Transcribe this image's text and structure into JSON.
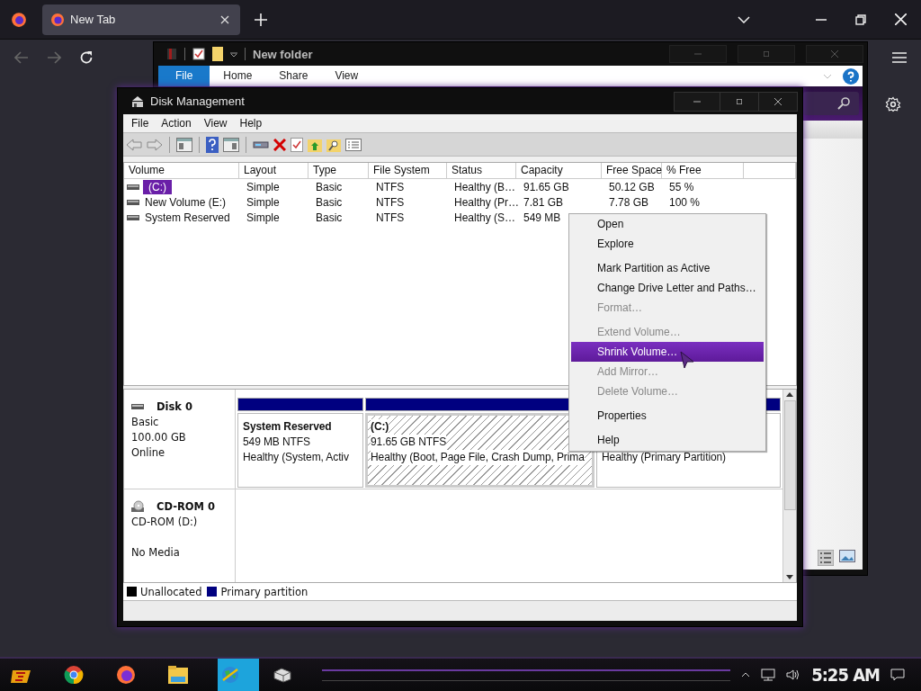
{
  "browser": {
    "tabs": [
      {
        "title": "New Tab",
        "selected": true
      }
    ]
  },
  "explorer": {
    "title": "New folder",
    "ribbon_tabs": [
      {
        "label": "File",
        "selected": true
      },
      {
        "label": "Home",
        "selected": false
      },
      {
        "label": "Share",
        "selected": false
      },
      {
        "label": "View",
        "selected": false
      }
    ]
  },
  "disk_management": {
    "title": "Disk Management",
    "menu": [
      "File",
      "Action",
      "View",
      "Help"
    ],
    "volume_table": {
      "columns": [
        "Volume",
        "Layout",
        "Type",
        "File System",
        "Status",
        "Capacity",
        "Free Space",
        "% Free"
      ],
      "rows": [
        {
          "cells": [
            "(C:)",
            "Simple",
            "Basic",
            "NTFS",
            "Healthy (B…",
            "91.65 GB",
            "50.12 GB",
            "55 %"
          ],
          "selected": true
        },
        {
          "cells": [
            "New Volume (E:)",
            "Simple",
            "Basic",
            "NTFS",
            "Healthy (Pr…",
            "7.81 GB",
            "7.78 GB",
            "100 %"
          ],
          "selected": false
        },
        {
          "cells": [
            "System Reserved",
            "Simple",
            "Basic",
            "NTFS",
            "Healthy (S…",
            "549 MB"
          ],
          "selected": false
        }
      ]
    },
    "disks": [
      {
        "name": "Disk 0",
        "kind": "disk",
        "type": "Basic",
        "size": "100.00 GB",
        "status": "Online",
        "partitions": [
          {
            "title": "System Reserved",
            "size": "549 MB NTFS",
            "status": "Healthy (System, Activ",
            "selected": false
          },
          {
            "title": "(C:)",
            "size": "91.65 GB NTFS",
            "status": "Healthy (Boot, Page File, Crash Dump, Prima",
            "selected": true
          },
          {
            "status": "Healthy (Primary Partition)",
            "selected": false
          }
        ]
      },
      {
        "name": "CD-ROM 0",
        "kind": "cdrom",
        "type": "CD-ROM (D:)",
        "status": "No Media"
      }
    ],
    "legend": [
      {
        "label": "Unallocated",
        "color": "#000000"
      },
      {
        "label": "Primary partition",
        "color": "#000080"
      }
    ]
  },
  "context_menu": {
    "groups": [
      [
        {
          "label": "Open",
          "disabled": false,
          "selected": false
        },
        {
          "label": "Explore",
          "disabled": false,
          "selected": false
        }
      ],
      [
        {
          "label": "Mark Partition as Active",
          "disabled": false,
          "selected": false
        },
        {
          "label": "Change Drive Letter and Paths…",
          "disabled": false,
          "selected": false
        },
        {
          "label": "Format…",
          "disabled": true,
          "selected": false
        }
      ],
      [
        {
          "label": "Extend Volume…",
          "disabled": true,
          "selected": false
        },
        {
          "label": "Shrink Volume…",
          "disabled": false,
          "selected": true
        },
        {
          "label": "Add Mirror…",
          "disabled": true,
          "selected": false
        },
        {
          "label": "Delete Volume…",
          "disabled": true,
          "selected": false
        }
      ],
      [
        {
          "label": "Properties",
          "disabled": false,
          "selected": false
        }
      ],
      [
        {
          "label": "Help",
          "disabled": false,
          "selected": false
        }
      ]
    ]
  },
  "taskbar": {
    "apps": [
      {
        "kind": "start",
        "selected": false
      },
      {
        "kind": "chrome",
        "selected": false
      },
      {
        "kind": "firefox",
        "selected": false
      },
      {
        "kind": "folder",
        "selected": false
      },
      {
        "kind": "globe",
        "selected": true
      },
      {
        "kind": "drive",
        "selected": false
      }
    ],
    "clock": "5:25 AM"
  }
}
